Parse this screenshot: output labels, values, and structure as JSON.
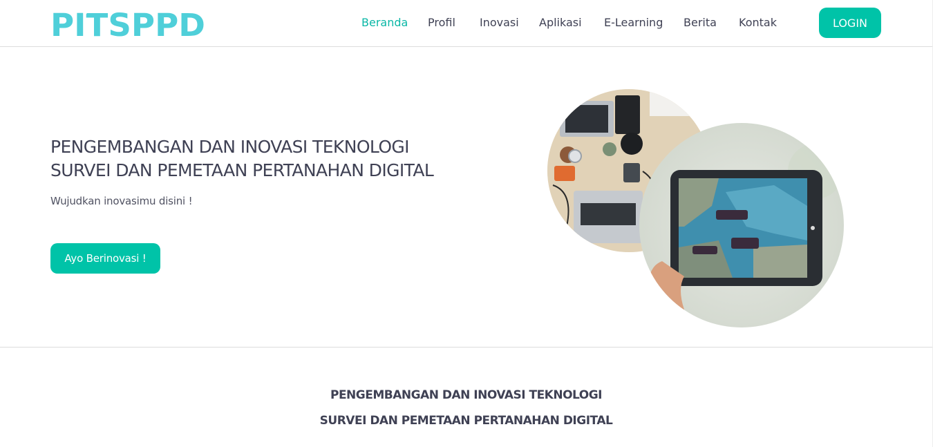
{
  "brand": {
    "logo_text": "PITSPPD",
    "logo_color": "#4fcfd9"
  },
  "nav": {
    "items": [
      {
        "label": "Beranda",
        "active": true
      },
      {
        "label": "Profil"
      },
      {
        "label": "Inovasi"
      },
      {
        "label": "Aplikasi"
      },
      {
        "label": "E-Learning"
      },
      {
        "label": "Berita"
      },
      {
        "label": "Kontak"
      }
    ],
    "login_label": "LOGIN"
  },
  "hero": {
    "title_line1": "PENGEMBANGAN DAN INOVASI TEKNOLOGI",
    "title_line2": "SURVEI DAN PEMETAAN PERTANAHAN DIGITAL",
    "subtitle": "Wujudkan inovasimu disini !",
    "cta_label": "Ayo Berinovasi !",
    "images": [
      "desk-with-laptops-photo",
      "tablet-showing-map-photo"
    ]
  },
  "section": {
    "title_line1": "PENGEMBANGAN DAN INOVASI TEKNOLOGI",
    "title_line2": "SURVEI DAN PEMETAAN PERTANAHAN DIGITAL"
  },
  "colors": {
    "accent": "#00c3a8",
    "active_link": "#0ab7a6",
    "text": "#3f4154"
  }
}
